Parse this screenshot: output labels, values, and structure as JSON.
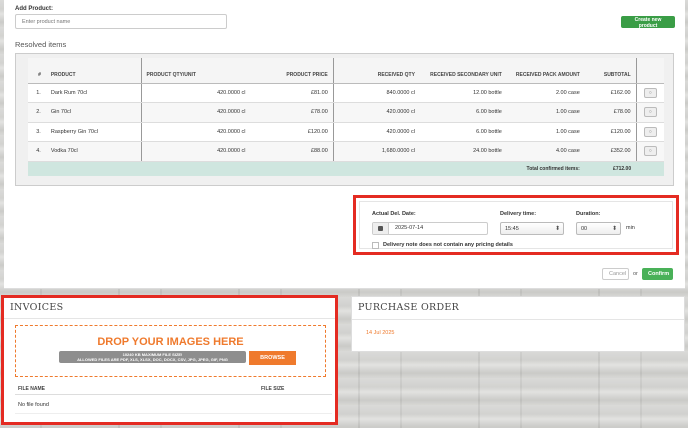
{
  "add_product": {
    "label": "Add Product:",
    "placeholder": "Enter product name",
    "create_button": "Create new product"
  },
  "resolved": {
    "title": "Resolved items",
    "headers": {
      "num": "#",
      "product": "PRODUCT",
      "qty_unit": "PRODUCT QTY/UNIT",
      "price": "PRODUCT PRICE",
      "received_qty": "RECEIVED QTY",
      "received_secondary": "RECEIVED SECONDARY UNIT",
      "received_pack": "RECEIVED PACK AMOUNT",
      "subtotal": "SUBTOTAL"
    },
    "rows": [
      {
        "num": "1.",
        "product": "Dark Rum 70cl",
        "qty_unit": "420.0000 cl",
        "price": "£81.00",
        "received_qty": "840.0000 cl",
        "secondary": "12.00 bottle",
        "pack": "2.00 case",
        "subtotal": "£162.00"
      },
      {
        "num": "2.",
        "product": "Gin 70cl",
        "qty_unit": "420.0000 cl",
        "price": "£78.00",
        "received_qty": "420.0000 cl",
        "secondary": "6.00 bottle",
        "pack": "1.00 case",
        "subtotal": "£78.00"
      },
      {
        "num": "3.",
        "product": "Raspberry Gin 70cl",
        "qty_unit": "420.0000 cl",
        "price": "£120.00",
        "received_qty": "420.0000 cl",
        "secondary": "6.00 bottle",
        "pack": "1.00 case",
        "subtotal": "£120.00"
      },
      {
        "num": "4.",
        "product": "Vodka 70cl",
        "qty_unit": "420.0000 cl",
        "price": "£88.00",
        "received_qty": "1,680.0000 cl",
        "secondary": "24.00 bottle",
        "pack": "4.00 case",
        "subtotal": "£352.00"
      }
    ],
    "total_label": "Total confirmed items:",
    "total_value": "£712.00",
    "row_action_icon": "○"
  },
  "delivery": {
    "date_label": "Actual Del. Date:",
    "date_value": "2025-07-14",
    "time_label": "Delivery time:",
    "time_value": "15:45",
    "duration_label": "Duration:",
    "duration_value": "00",
    "duration_unit": "min",
    "note_label": "Delivery note does not contain any pricing details"
  },
  "actions": {
    "cancel": "Cancel",
    "or": "or",
    "confirm": "Confirm"
  },
  "invoices": {
    "title": "INVOICES",
    "drop_title": "DROP YOUR IMAGES HERE",
    "drop_info_1": "10240 KB MAXIMUM FILE SIZE!",
    "drop_info_2": "ALLOWED FILES ARE PDF, XLS, XLSX, DOC, DOCX, CSV, JPG, JPEG, GIF, PNG",
    "browse": "BROWSE",
    "col_file_name": "FILE NAME",
    "col_file_size": "FILE SIZE",
    "empty": "No file found"
  },
  "purchase_order": {
    "title": "PURCHASE ORDER",
    "date": "14 Jul 2025"
  },
  "colors": {
    "accent_orange": "#ef7a2d",
    "highlight_red": "#e42b22",
    "confirm_green": "#49b158",
    "total_row": "#cfe6df"
  }
}
